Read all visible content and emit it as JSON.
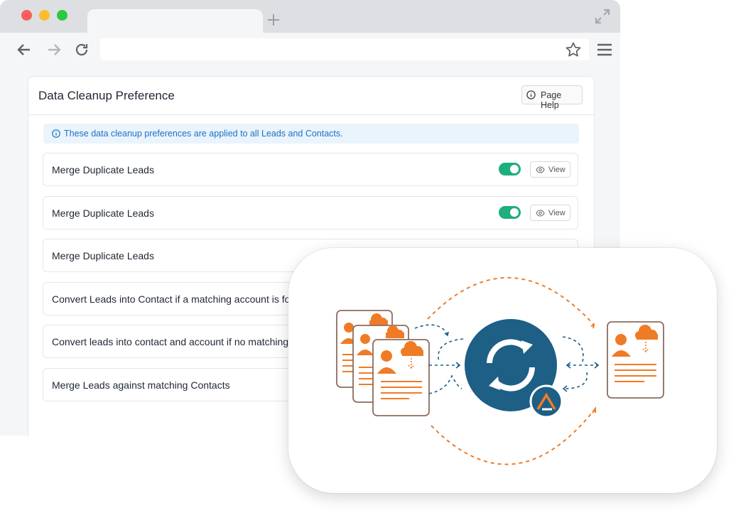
{
  "page": {
    "title": "Data Cleanup Preference",
    "help_button": "Page Help",
    "info_banner": "These data cleanup preferences are applied to all Leads and Contacts.",
    "view_label": "View",
    "rows": [
      {
        "label": "Merge Duplicate Leads",
        "enabled": true
      },
      {
        "label": "Merge Duplicate Leads",
        "enabled": true
      },
      {
        "label": "Merge Duplicate Leads"
      },
      {
        "label": "Convert Leads into Contact if a matching account is fo"
      },
      {
        "label": "Convert leads into contact and account if no matching"
      },
      {
        "label": "Merge Leads against matching Contacts"
      }
    ]
  },
  "colors": {
    "accent_orange": "#f07b26",
    "sync_blue": "#1d5f85",
    "toggle_green": "#1fae7d",
    "info_blue": "#1e71c4"
  },
  "icons": [
    "back-arrow-icon",
    "forward-arrow-icon",
    "reload-icon",
    "star-icon",
    "hamburger-menu-icon",
    "plus-icon",
    "expand-icon",
    "info-icon",
    "eye-icon",
    "sync-icon",
    "cloud-icon",
    "person-icon"
  ]
}
